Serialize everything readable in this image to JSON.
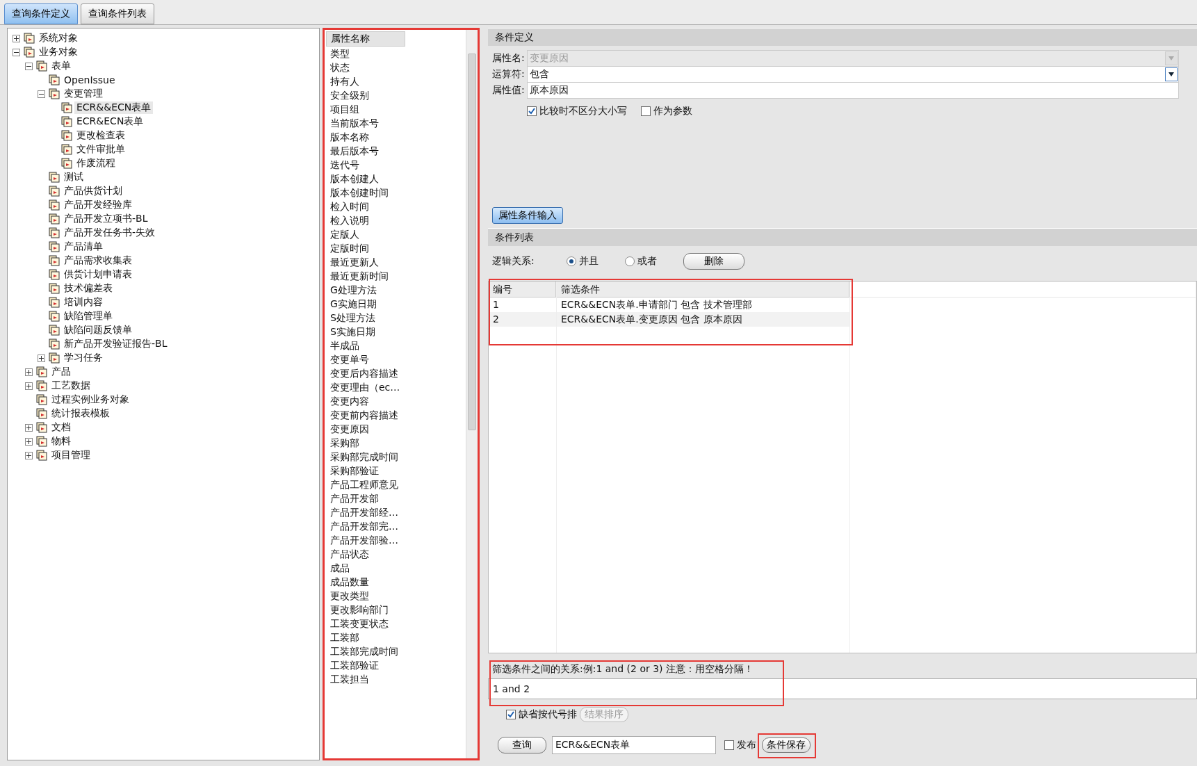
{
  "tabs": [
    {
      "label": "查询条件定义",
      "selected": true
    },
    {
      "label": "查询条件列表",
      "selected": false
    }
  ],
  "tree": [
    {
      "label": "系统对象",
      "expanded": false
    },
    {
      "label": "业务对象",
      "expanded": true,
      "children": [
        {
          "label": "表单",
          "expanded": true,
          "children": [
            {
              "label": "OpenIssue"
            },
            {
              "label": "变更管理",
              "expanded": true,
              "children": [
                {
                  "label": "ECR&&ECN表单",
                  "selected": true
                },
                {
                  "label": "ECR&ECN表单",
                  "selected": false
                },
                {
                  "label": "更改检查表",
                  "selected": false
                },
                {
                  "label": "文件审批单",
                  "selected": false
                },
                {
                  "label": "作废流程",
                  "selected": false
                }
              ]
            },
            {
              "label": "测试"
            },
            {
              "label": "产品供货计划"
            },
            {
              "label": "产品开发经验库"
            },
            {
              "label": "产品开发立项书-BL"
            },
            {
              "label": "产品开发任务书-失效"
            },
            {
              "label": "产品清单"
            },
            {
              "label": "产品需求收集表"
            },
            {
              "label": "供货计划申请表"
            },
            {
              "label": "技术偏差表"
            },
            {
              "label": "培训内容"
            },
            {
              "label": "缺陷管理单"
            },
            {
              "label": "缺陷问题反馈单"
            },
            {
              "label": "新产品开发验证报告-BL"
            },
            {
              "label": "学习任务",
              "expanded": false
            }
          ]
        },
        {
          "label": "产品",
          "expanded": false
        },
        {
          "label": "工艺数据",
          "expanded": false
        },
        {
          "label": "过程实例业务对象"
        },
        {
          "label": "统计报表模板"
        },
        {
          "label": "文档",
          "expanded": false
        },
        {
          "label": "物料",
          "expanded": false
        },
        {
          "label": "项目管理",
          "expanded": false
        }
      ]
    }
  ],
  "attribute_list": {
    "header": "属性名称",
    "items": [
      "类型",
      "状态",
      "持有人",
      "安全级别",
      "项目组",
      "当前版本号",
      "版本名称",
      "最后版本号",
      "迭代号",
      "版本创建人",
      "版本创建时间",
      "检入时间",
      "检入说明",
      "定版人",
      "定版时间",
      "最近更新人",
      "最近更新时间",
      "G处理方法",
      "G实施日期",
      "S处理方法",
      "S实施日期",
      "半成品",
      "变更单号",
      "变更后内容描述",
      "变更理由（ec…",
      "变更内容",
      "变更前内容描述",
      "变更原因",
      "采购部",
      "采购部完成时间",
      "采购部验证",
      "产品工程师意见",
      "产品开发部",
      "产品开发部经…",
      "产品开发部完…",
      "产品开发部验…",
      "产品状态",
      "成品",
      "成品数量",
      "更改类型",
      "更改影响部门",
      "工装变更状态",
      "工装部",
      "工装部完成时间",
      "工装部验证",
      "工装担当"
    ]
  },
  "condition_definition": {
    "title": "条件定义",
    "fields": [
      {
        "label": "属性名:",
        "value": "变更原因",
        "kind": "dropdown",
        "disabled": true
      },
      {
        "label": "运算符:",
        "value": "包含",
        "kind": "dropdown",
        "disabled": false
      },
      {
        "label": "属性值:",
        "value": "原本原因",
        "kind": "text",
        "disabled": false
      }
    ],
    "options": [
      {
        "label": "比较时不区分大小写",
        "checked": true
      },
      {
        "label": "作为参数",
        "checked": false
      }
    ],
    "button": "属性条件输入"
  },
  "condition_list": {
    "title": "条件列表",
    "logic_label": "逻辑关系:",
    "logic_options": [
      {
        "label": "并且",
        "selected": true
      },
      {
        "label": "或者",
        "selected": false
      }
    ],
    "delete_button": "删除",
    "table": {
      "columns": [
        "编号",
        "筛选条件"
      ],
      "rows": [
        [
          "1",
          "ECR&&ECN表单.申请部门 包含 技术管理部"
        ],
        [
          "2",
          "ECR&&ECN表单.变更原因 包含 原本原因"
        ]
      ]
    }
  },
  "relation": {
    "hint": "筛选条件之间的关系:例:1 and (2 or 3)   注意：用空格分隔！",
    "value": "1 and 2"
  },
  "sorting": {
    "label": "缺省按代号排",
    "checked": true,
    "button": "结果排序"
  },
  "footer": {
    "query_button": "查询",
    "query_value": "ECR&&ECN表单",
    "publish_label": "发布",
    "publish_checked": false,
    "save_button": "条件保存"
  }
}
